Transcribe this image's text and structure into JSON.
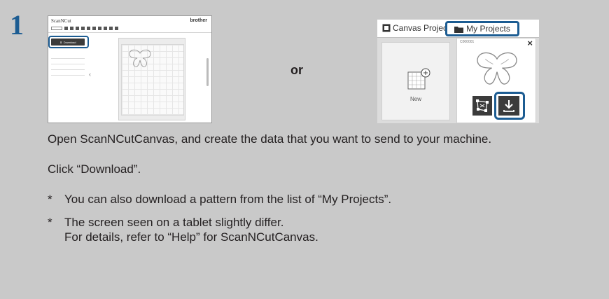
{
  "step_number": "1",
  "or_label": "or",
  "left_screenshot": {
    "logo": "ScanNCut",
    "brand": "brother",
    "download_button": "Download",
    "canvas_label": "ScanNCut"
  },
  "right_screenshot": {
    "tab_canvas_project": "Canvas Project",
    "tab_my_projects": "My Projects",
    "new_label": "New",
    "project_id": "C000001",
    "close_glyph": "×"
  },
  "instructions": {
    "line1": "Open ScanNCutCanvas, and create the data that you want to send to your machine.",
    "line2": "Click “Download”."
  },
  "notes": [
    {
      "bullet": "*",
      "text": "You can also download a pattern from the list of “My Projects”."
    },
    {
      "bullet": "*",
      "line1": "The screen seen on a tablet slightly differ.",
      "line2": "For details, refer to “Help” for ScanNCutCanvas."
    }
  ],
  "colors": {
    "background": "#c9c9c9",
    "accent": "#1c5c92",
    "text": "#231f20",
    "dark_button": "#3b3b3b"
  }
}
